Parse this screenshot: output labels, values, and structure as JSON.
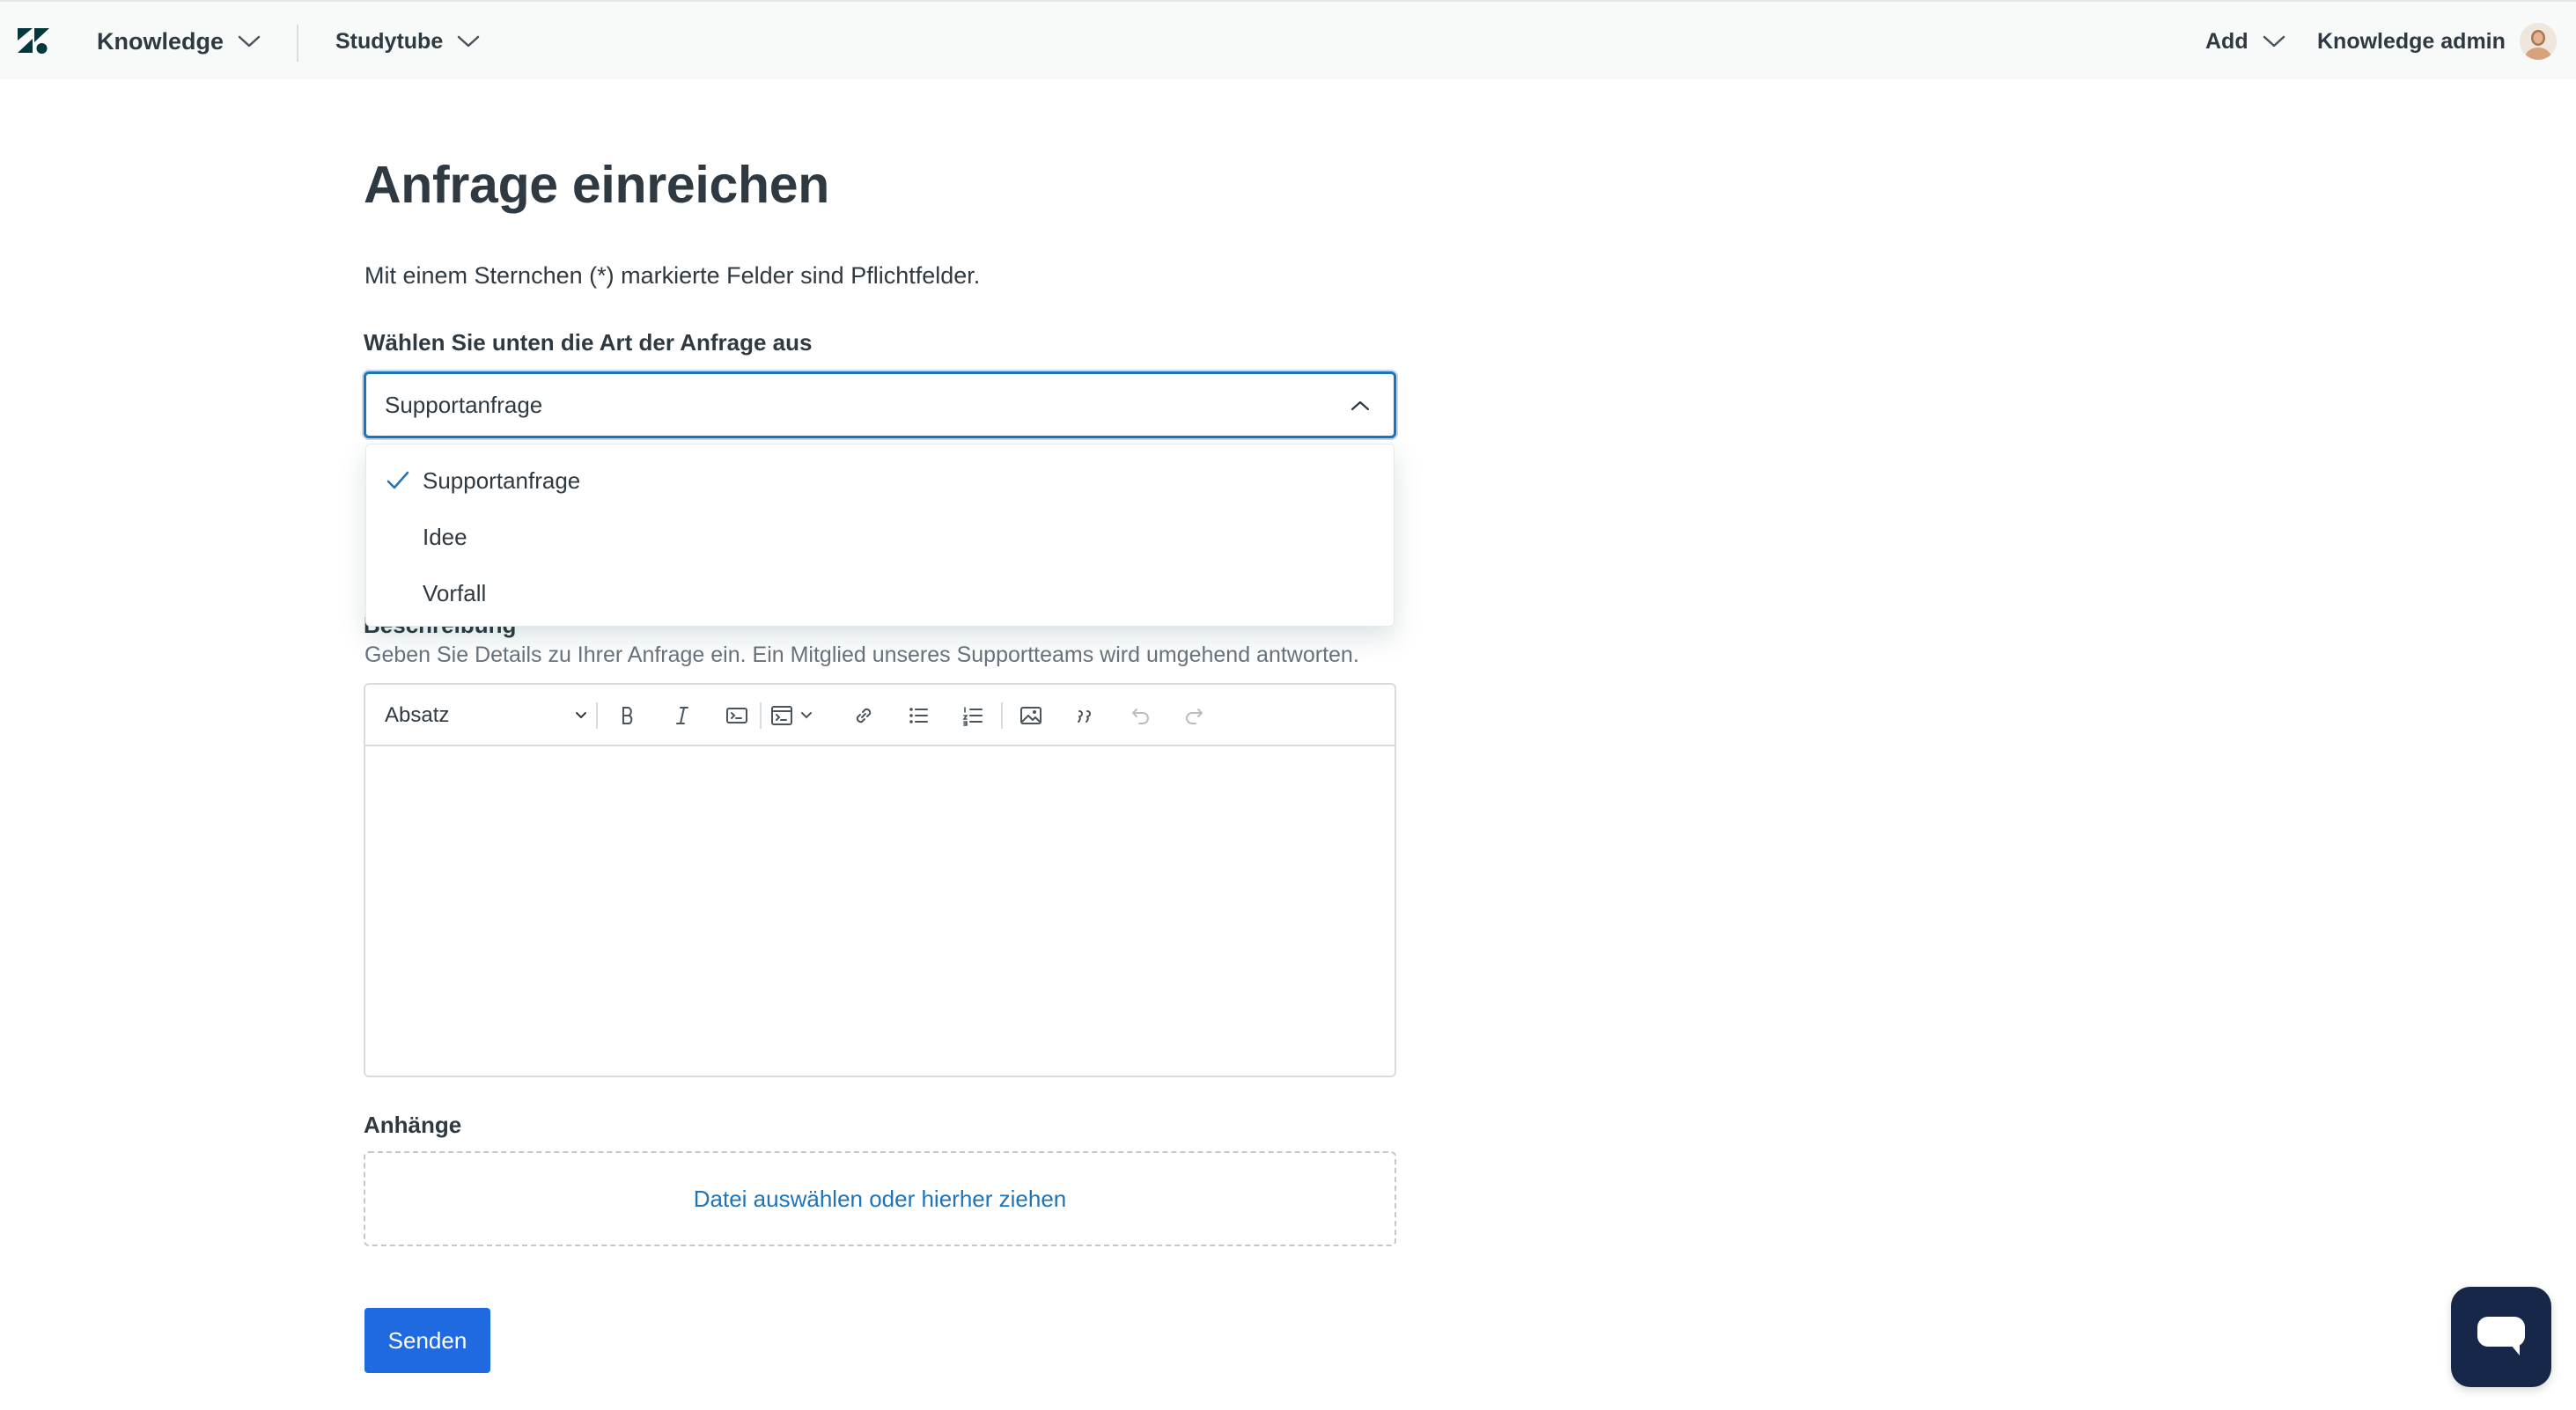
{
  "topbar": {
    "product_label": "Knowledge",
    "brand_label": "Studytube",
    "add_label": "Add",
    "admin_label": "Knowledge admin",
    "icons": {
      "logo": "zendesk-logo-icon",
      "chevrons": "chevron-down-icon",
      "avatar": "user-avatar"
    }
  },
  "form": {
    "title": "Anfrage einreichen",
    "required_note": "Mit einem Sternchen (*) markierte Felder sind Pflichtfelder.",
    "type_label": "Wählen Sie unten die Art der Anfrage aus",
    "type_selected": "Supportanfrage",
    "type_options": [
      "Supportanfrage",
      "Idee",
      "Vorfall"
    ],
    "description_label": "Beschreibung",
    "description_hint": "Geben Sie Details zu Ihrer Anfrage ein. Ein Mitglied unseres Supportteams wird umgehend antworten.",
    "editor": {
      "paragraph_select": "Absatz",
      "tools": [
        "bold-icon",
        "italic-icon",
        "code-icon",
        "code-block-icon",
        "link-icon",
        "bulleted-list-icon",
        "numbered-list-icon",
        "image-icon",
        "quote-icon",
        "undo-icon",
        "redo-icon"
      ]
    },
    "attachments_label": "Anhänge",
    "attachments_dropzone": "Datei auswählen oder hierher ziehen",
    "submit_label": "Senden"
  },
  "colors": {
    "accent": "#1f73b7",
    "submit": "#1f6ae0",
    "chat_button": "#17274a",
    "text": "#2f3941",
    "muted": "#68737d"
  }
}
